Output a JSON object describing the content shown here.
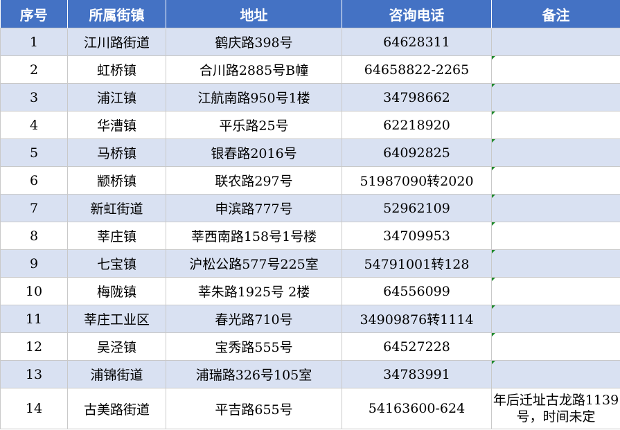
{
  "headers": [
    "序号",
    "所属街镇",
    "地址",
    "咨询电话",
    "备注"
  ],
  "rows": [
    {
      "no": "1",
      "town": "江川路街道",
      "address": "鹤庆路398号",
      "phone": "64628311",
      "note": ""
    },
    {
      "no": "2",
      "town": "虹桥镇",
      "address": "合川路2885号B幢",
      "phone": "64658822-2265",
      "note": ""
    },
    {
      "no": "3",
      "town": "浦江镇",
      "address": "江航南路950号1楼",
      "phone": "34798662",
      "note": ""
    },
    {
      "no": "4",
      "town": "华漕镇",
      "address": "平乐路25号",
      "phone": "62218920",
      "note": ""
    },
    {
      "no": "5",
      "town": "马桥镇",
      "address": "银春路2016号",
      "phone": "64092825",
      "note": ""
    },
    {
      "no": "6",
      "town": "颛桥镇",
      "address": "联农路297号",
      "phone": "51987090转2020",
      "note": ""
    },
    {
      "no": "7",
      "town": "新虹街道",
      "address": "申滨路777号",
      "phone": "52962109",
      "note": ""
    },
    {
      "no": "8",
      "town": "莘庄镇",
      "address": "莘西南路158号1号楼",
      "phone": "34709953",
      "note": ""
    },
    {
      "no": "9",
      "town": "七宝镇",
      "address": "沪松公路577号225室",
      "phone": "54791001转128",
      "note": ""
    },
    {
      "no": "10",
      "town": "梅陇镇",
      "address": "莘朱路1925号 2楼",
      "phone": "64556099",
      "note": ""
    },
    {
      "no": "11",
      "town": "莘庄工业区",
      "address": "春光路710号",
      "phone": "34909876转1114",
      "note": ""
    },
    {
      "no": "12",
      "town": "吴泾镇",
      "address": "宝秀路555号",
      "phone": "64527228",
      "note": ""
    },
    {
      "no": "13",
      "town": "浦锦街道",
      "address": "浦瑞路326号105室",
      "phone": "34783991",
      "note": ""
    },
    {
      "no": "14",
      "town": "古美路街道",
      "address": "平吉路655号",
      "phone": "54163600-624",
      "note": "年后迁址古龙路1139号，时间未定"
    }
  ]
}
